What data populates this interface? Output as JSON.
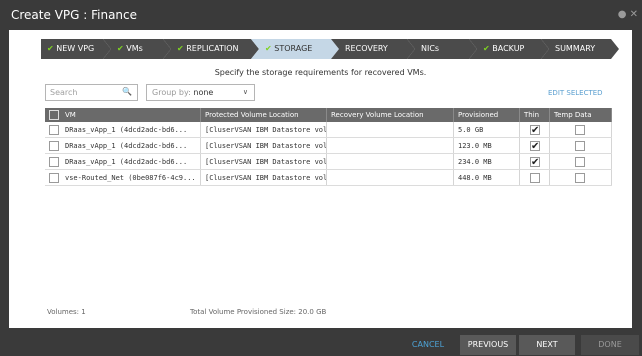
{
  "window": {
    "title": "Create VPG : Finance"
  },
  "steps": [
    {
      "label": "NEW VPG",
      "done": true
    },
    {
      "label": "VMs",
      "done": true
    },
    {
      "label": "REPLICATION",
      "done": true
    },
    {
      "label": "STORAGE",
      "done": true,
      "active": true
    },
    {
      "label": "RECOVERY",
      "done": false
    },
    {
      "label": "NICs",
      "done": false
    },
    {
      "label": "BACKUP",
      "done": true
    },
    {
      "label": "SUMMARY",
      "done": false
    }
  ],
  "subtitle": "Specify the storage requirements for recovered VMs.",
  "filters": {
    "search_placeholder": "Search",
    "group_label": "Group by:",
    "group_value": "none",
    "edit_selected": "EDIT SELECTED"
  },
  "table": {
    "headers": [
      "VM",
      "Protected Volume Location",
      "Recovery Volume Location",
      "Provisioned",
      "Thin",
      "Temp Data"
    ],
    "rows": [
      {
        "vm": "DRaas_vApp_1 (4dcd2adc-bd6...",
        "protected": "[CluserVSAN IBM Datastore vol...",
        "recovery": "",
        "provisioned": "5.0 GB",
        "thin": true,
        "temp": false
      },
      {
        "vm": "DRaas_vApp_1 (4dcd2adc-bd6...",
        "protected": "[CluserVSAN IBM Datastore vol...",
        "recovery": "",
        "provisioned": "123.0 MB",
        "thin": true,
        "temp": false
      },
      {
        "vm": "DRaas_vApp_1 (4dcd2adc-bd6...",
        "protected": "[CluserVSAN IBM Datastore vol...",
        "recovery": "",
        "provisioned": "234.0 MB",
        "thin": true,
        "temp": false
      },
      {
        "vm": "vse-Routed_Net (0be087f6-4c9...",
        "protected": "[CluserVSAN IBM Datastore vol...",
        "recovery": "",
        "provisioned": "448.0 MB",
        "thin": false,
        "temp": false
      }
    ]
  },
  "footer": {
    "volumes": "Volumes: 1",
    "total": "Total Volume Provisioned Size: 20.0 GB"
  },
  "buttons": {
    "cancel": "CANCEL",
    "previous": "PREVIOUS",
    "next": "NEXT",
    "done": "DONE"
  },
  "colors": {
    "accent": "#4da3d6",
    "check": "#7ed321",
    "active_step": "#c5d7e6"
  }
}
